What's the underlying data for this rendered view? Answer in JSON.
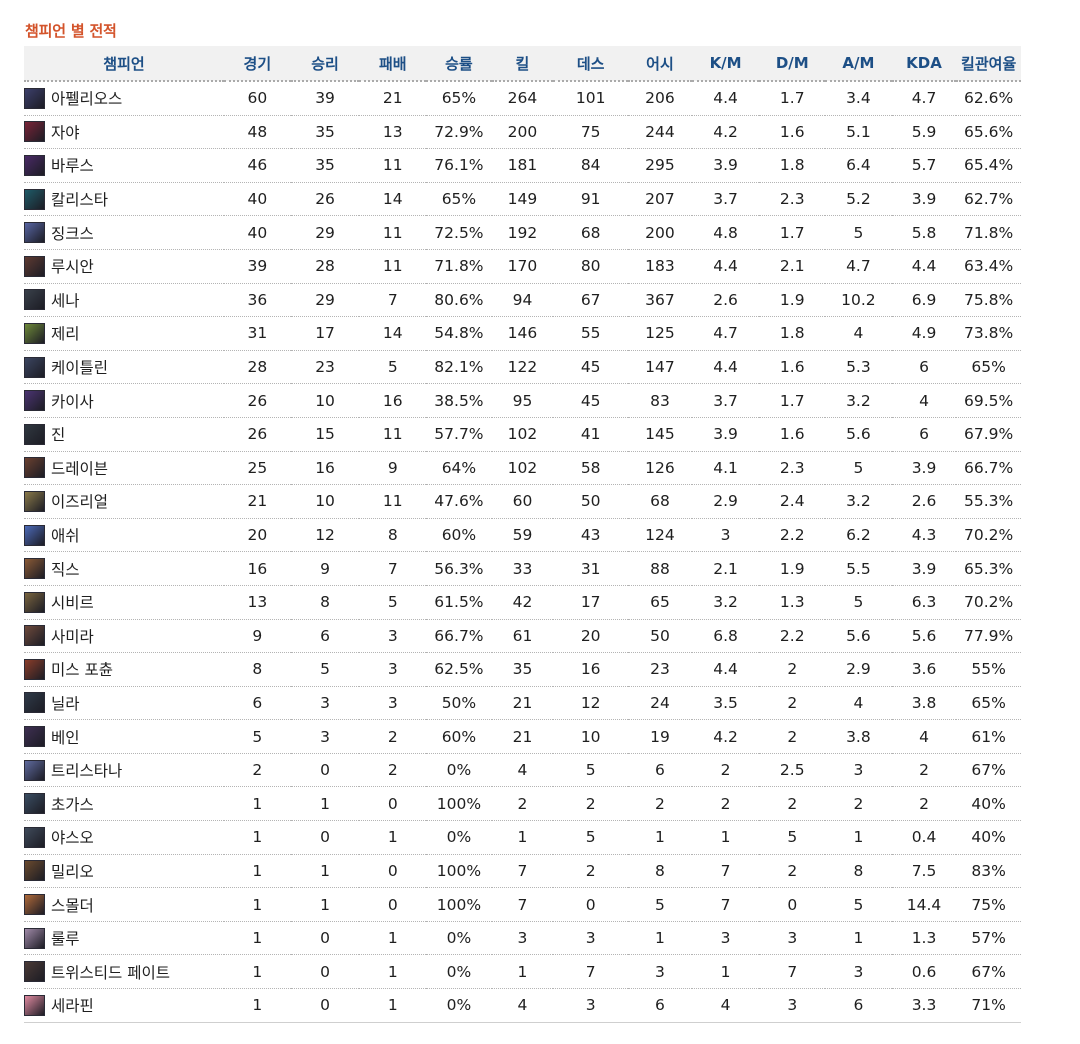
{
  "title": "챔피언 별 전적",
  "headers": [
    "챔피언",
    "경기",
    "승리",
    "패배",
    "승률",
    "킬",
    "데스",
    "어시",
    "K/M",
    "D/M",
    "A/M",
    "KDA",
    "킬관여율"
  ],
  "rows": [
    {
      "champion": "아펠리오스",
      "avatar_color": "#3c3f6b",
      "cells": [
        "60",
        "39",
        "21",
        "65%",
        "264",
        "101",
        "206",
        "4.4",
        "1.7",
        "3.4",
        "4.7",
        "62.6%"
      ]
    },
    {
      "champion": "자야",
      "avatar_color": "#7a2438",
      "cells": [
        "48",
        "35",
        "13",
        "72.9%",
        "200",
        "75",
        "244",
        "4.2",
        "1.6",
        "5.1",
        "5.9",
        "65.6%"
      ]
    },
    {
      "champion": "바루스",
      "avatar_color": "#4a2a66",
      "cells": [
        "46",
        "35",
        "11",
        "76.1%",
        "181",
        "84",
        "295",
        "3.9",
        "1.8",
        "6.4",
        "5.7",
        "65.4%"
      ]
    },
    {
      "champion": "칼리스타",
      "avatar_color": "#1f5b68",
      "cells": [
        "40",
        "26",
        "14",
        "65%",
        "149",
        "91",
        "207",
        "3.7",
        "2.3",
        "5.2",
        "3.9",
        "62.7%"
      ]
    },
    {
      "champion": "징크스",
      "avatar_color": "#5866a3",
      "cells": [
        "40",
        "29",
        "11",
        "72.5%",
        "192",
        "68",
        "200",
        "4.8",
        "1.7",
        "5",
        "5.8",
        "71.8%"
      ]
    },
    {
      "champion": "루시안",
      "avatar_color": "#5e3a32",
      "cells": [
        "39",
        "28",
        "11",
        "71.8%",
        "170",
        "80",
        "183",
        "4.4",
        "2.1",
        "4.7",
        "4.4",
        "63.4%"
      ]
    },
    {
      "champion": "세나",
      "avatar_color": "#39404a",
      "cells": [
        "36",
        "29",
        "7",
        "80.6%",
        "94",
        "67",
        "367",
        "2.6",
        "1.9",
        "10.2",
        "6.9",
        "75.8%"
      ]
    },
    {
      "champion": "제리",
      "avatar_color": "#6f8a3a",
      "cells": [
        "31",
        "17",
        "14",
        "54.8%",
        "146",
        "55",
        "125",
        "4.7",
        "1.8",
        "4",
        "4.9",
        "73.8%"
      ]
    },
    {
      "champion": "케이틀린",
      "avatar_color": "#3b4560",
      "cells": [
        "28",
        "23",
        "5",
        "82.1%",
        "122",
        "45",
        "147",
        "4.4",
        "1.6",
        "5.3",
        "6",
        "65%"
      ]
    },
    {
      "champion": "카이사",
      "avatar_color": "#4b3472",
      "cells": [
        "26",
        "10",
        "16",
        "38.5%",
        "95",
        "45",
        "83",
        "3.7",
        "1.7",
        "3.2",
        "4",
        "69.5%"
      ]
    },
    {
      "champion": "진",
      "avatar_color": "#303840",
      "cells": [
        "26",
        "15",
        "11",
        "57.7%",
        "102",
        "41",
        "145",
        "3.9",
        "1.6",
        "5.6",
        "6",
        "67.9%"
      ]
    },
    {
      "champion": "드레이븐",
      "avatar_color": "#6a4030",
      "cells": [
        "25",
        "16",
        "9",
        "64%",
        "102",
        "58",
        "126",
        "4.1",
        "2.3",
        "5",
        "3.9",
        "66.7%"
      ]
    },
    {
      "champion": "이즈리얼",
      "avatar_color": "#8a7a4a",
      "cells": [
        "21",
        "10",
        "11",
        "47.6%",
        "60",
        "50",
        "68",
        "2.9",
        "2.4",
        "3.2",
        "2.6",
        "55.3%"
      ]
    },
    {
      "champion": "애쉬",
      "avatar_color": "#4c6ab8",
      "cells": [
        "20",
        "12",
        "8",
        "60%",
        "59",
        "43",
        "124",
        "3",
        "2.2",
        "6.2",
        "4.3",
        "70.2%"
      ]
    },
    {
      "champion": "직스",
      "avatar_color": "#8a5a36",
      "cells": [
        "16",
        "9",
        "7",
        "56.3%",
        "33",
        "31",
        "88",
        "2.1",
        "1.9",
        "5.5",
        "3.9",
        "65.3%"
      ]
    },
    {
      "champion": "시비르",
      "avatar_color": "#7a6540",
      "cells": [
        "13",
        "8",
        "5",
        "61.5%",
        "42",
        "17",
        "65",
        "3.2",
        "1.3",
        "5",
        "6.3",
        "70.2%"
      ]
    },
    {
      "champion": "사미라",
      "avatar_color": "#6e4a3c",
      "cells": [
        "9",
        "6",
        "3",
        "66.7%",
        "61",
        "20",
        "50",
        "6.8",
        "2.2",
        "5.6",
        "5.6",
        "77.9%"
      ]
    },
    {
      "champion": "미스 포츈",
      "avatar_color": "#8a3d2a",
      "cells": [
        "8",
        "5",
        "3",
        "62.5%",
        "35",
        "16",
        "23",
        "4.4",
        "2",
        "2.9",
        "3.6",
        "55%"
      ]
    },
    {
      "champion": "닐라",
      "avatar_color": "#2f3a48",
      "cells": [
        "6",
        "3",
        "3",
        "50%",
        "21",
        "12",
        "24",
        "3.5",
        "2",
        "4",
        "3.8",
        "65%"
      ]
    },
    {
      "champion": "베인",
      "avatar_color": "#3e2f52",
      "cells": [
        "5",
        "3",
        "2",
        "60%",
        "21",
        "10",
        "19",
        "4.2",
        "2",
        "3.8",
        "4",
        "61%"
      ]
    },
    {
      "champion": "트리스타나",
      "avatar_color": "#5f6a9e",
      "cells": [
        "2",
        "0",
        "2",
        "0%",
        "4",
        "5",
        "6",
        "2",
        "2.5",
        "3",
        "2",
        "67%"
      ]
    },
    {
      "champion": "초가스",
      "avatar_color": "#3a4d62",
      "cells": [
        "1",
        "1",
        "0",
        "100%",
        "2",
        "2",
        "2",
        "2",
        "2",
        "2",
        "2",
        "40%"
      ]
    },
    {
      "champion": "야스오",
      "avatar_color": "#3f4a5a",
      "cells": [
        "1",
        "0",
        "1",
        "0%",
        "1",
        "5",
        "1",
        "1",
        "5",
        "1",
        "0.4",
        "40%"
      ]
    },
    {
      "champion": "밀리오",
      "avatar_color": "#6a4a2e",
      "cells": [
        "1",
        "1",
        "0",
        "100%",
        "7",
        "2",
        "8",
        "7",
        "2",
        "8",
        "7.5",
        "83%"
      ]
    },
    {
      "champion": "스몰더",
      "avatar_color": "#b06a3a",
      "cells": [
        "1",
        "1",
        "0",
        "100%",
        "7",
        "0",
        "5",
        "7",
        "0",
        "5",
        "14.4",
        "75%"
      ]
    },
    {
      "champion": "룰루",
      "avatar_color": "#a08aa8",
      "cells": [
        "1",
        "0",
        "1",
        "0%",
        "3",
        "3",
        "1",
        "3",
        "3",
        "1",
        "1.3",
        "57%"
      ]
    },
    {
      "champion": "트위스티드 페이트",
      "avatar_color": "#4a3a36",
      "cells": [
        "1",
        "0",
        "1",
        "0%",
        "1",
        "7",
        "3",
        "1",
        "7",
        "3",
        "0.6",
        "67%"
      ]
    },
    {
      "champion": "세라핀",
      "avatar_color": "#e08aa0",
      "cells": [
        "1",
        "0",
        "1",
        "0%",
        "4",
        "3",
        "6",
        "4",
        "3",
        "6",
        "3.3",
        "71%"
      ]
    }
  ]
}
